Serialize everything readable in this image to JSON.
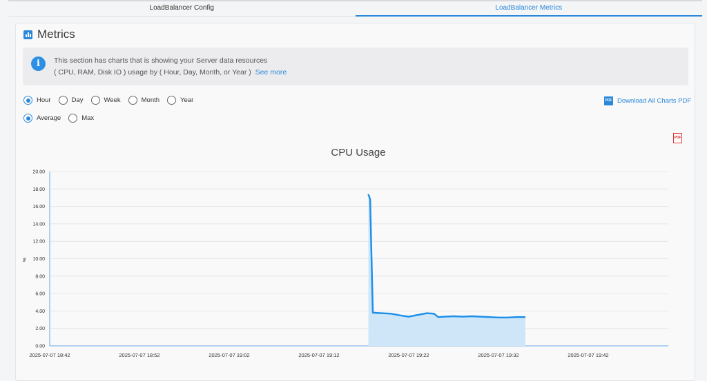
{
  "tabs": [
    {
      "label": "LoadBalancer Config",
      "active": false
    },
    {
      "label": "LoadBalancer Metrics",
      "active": true
    }
  ],
  "section": {
    "title": "Metrics",
    "info_line1": "This section has charts that is showing your Server data resources",
    "info_line2": "( CPU, RAM, Disk IO ) usage by ( Hour, Day, Month, or Year )",
    "see_more": "See more"
  },
  "period_options": [
    {
      "label": "Hour",
      "checked": true
    },
    {
      "label": "Day",
      "checked": false
    },
    {
      "label": "Week",
      "checked": false
    },
    {
      "label": "Month",
      "checked": false
    },
    {
      "label": "Year",
      "checked": false
    }
  ],
  "agg_options": [
    {
      "label": "Average",
      "checked": true
    },
    {
      "label": "Max",
      "checked": false
    }
  ],
  "download_label": "Download All Charts PDF",
  "pdf_icon_text": "PDF",
  "info_icon_text": "i",
  "colors": {
    "accent": "#2b88d8",
    "line": "#1e90ea",
    "fill": "#cfe6f8",
    "pdf_red": "#d33333"
  },
  "chart_data": {
    "type": "area",
    "title": "CPU Usage",
    "xlabel": "",
    "ylabel": "%",
    "ylim": [
      0,
      20
    ],
    "yticks": [
      "0.00",
      "2.00",
      "4.00",
      "6.00",
      "8.00",
      "10.00",
      "12.00",
      "14.00",
      "16.00",
      "18.00",
      "20.00"
    ],
    "xticks": [
      "2025-07-07 18:42",
      "2025-07-07 18:52",
      "2025-07-07 19:02",
      "2025-07-07 19:12",
      "2025-07-07 19:22",
      "2025-07-07 19:32",
      "2025-07-07 19:42"
    ],
    "grid": true,
    "x_minutes": [
      35.5,
      35.7,
      36.0,
      37.0,
      38.0,
      39.0,
      40.0,
      41.0,
      42.0,
      42.8,
      43.3,
      44.0,
      45.0,
      46.0,
      47.0,
      48.0,
      49.0,
      50.0,
      51.0,
      52.0,
      53.0
    ],
    "values": [
      17.4,
      16.8,
      3.8,
      3.75,
      3.7,
      3.5,
      3.35,
      3.55,
      3.75,
      3.7,
      3.3,
      3.35,
      3.4,
      3.35,
      3.4,
      3.35,
      3.3,
      3.25,
      3.25,
      3.3,
      3.3
    ]
  }
}
